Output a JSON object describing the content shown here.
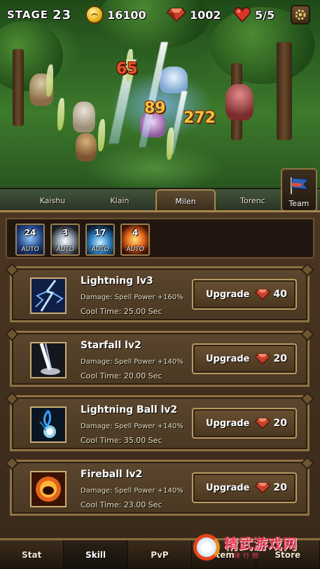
{
  "hud": {
    "stage_label": "STAGE",
    "stage_number": "23",
    "gold": "16100",
    "gems": "1002",
    "hearts": "5/5"
  },
  "battle": {
    "damage_numbers": [
      "65",
      "89",
      "272"
    ]
  },
  "characters": {
    "tabs": [
      "Kaishu",
      "Klain",
      "Milen",
      "Torenc"
    ],
    "active": "Milen",
    "team_label": "Team"
  },
  "auto_skills": [
    {
      "count": "24",
      "tag": "AUTO"
    },
    {
      "count": "3",
      "tag": "AUTO"
    },
    {
      "count": "17",
      "tag": "AUTO"
    },
    {
      "count": "4",
      "tag": "AUTO"
    }
  ],
  "skills": [
    {
      "name": "Lightning lv3",
      "damage": "Damage: Spell Power +160%",
      "cool": "Cool Time: 25.00 Sec",
      "upgrade_label": "Upgrade",
      "cost": "40",
      "icon": "lightning-icon"
    },
    {
      "name": "Starfall lv2",
      "damage": "Damage: Spell Power +140%",
      "cool": "Cool Time: 20.00 Sec",
      "upgrade_label": "Upgrade",
      "cost": "20",
      "icon": "starfall-icon"
    },
    {
      "name": "Lightning Ball lv2",
      "damage": "Damage: Spell Power +140%",
      "cool": "Cool Time: 35.00 Sec",
      "upgrade_label": "Upgrade",
      "cost": "20",
      "icon": "lightning-ball-icon"
    },
    {
      "name": "Fireball lv2",
      "damage": "Damage: Spell Power +140%",
      "cool": "Cool Time: 23.00 Sec",
      "upgrade_label": "Upgrade",
      "cost": "20",
      "icon": "fireball-icon"
    }
  ],
  "bottom_nav": {
    "tabs": [
      "Stat",
      "Skill",
      "PvP",
      "Item",
      "Store"
    ],
    "active": "Skill"
  },
  "watermark": {
    "text": "精武游戏网",
    "sub": "排行榜"
  },
  "colors": {
    "panel_bg": "#4a3622",
    "frame_gold": "#8f7244",
    "gem_red": "#c8402a",
    "gold_coin": "#e8b11c"
  }
}
